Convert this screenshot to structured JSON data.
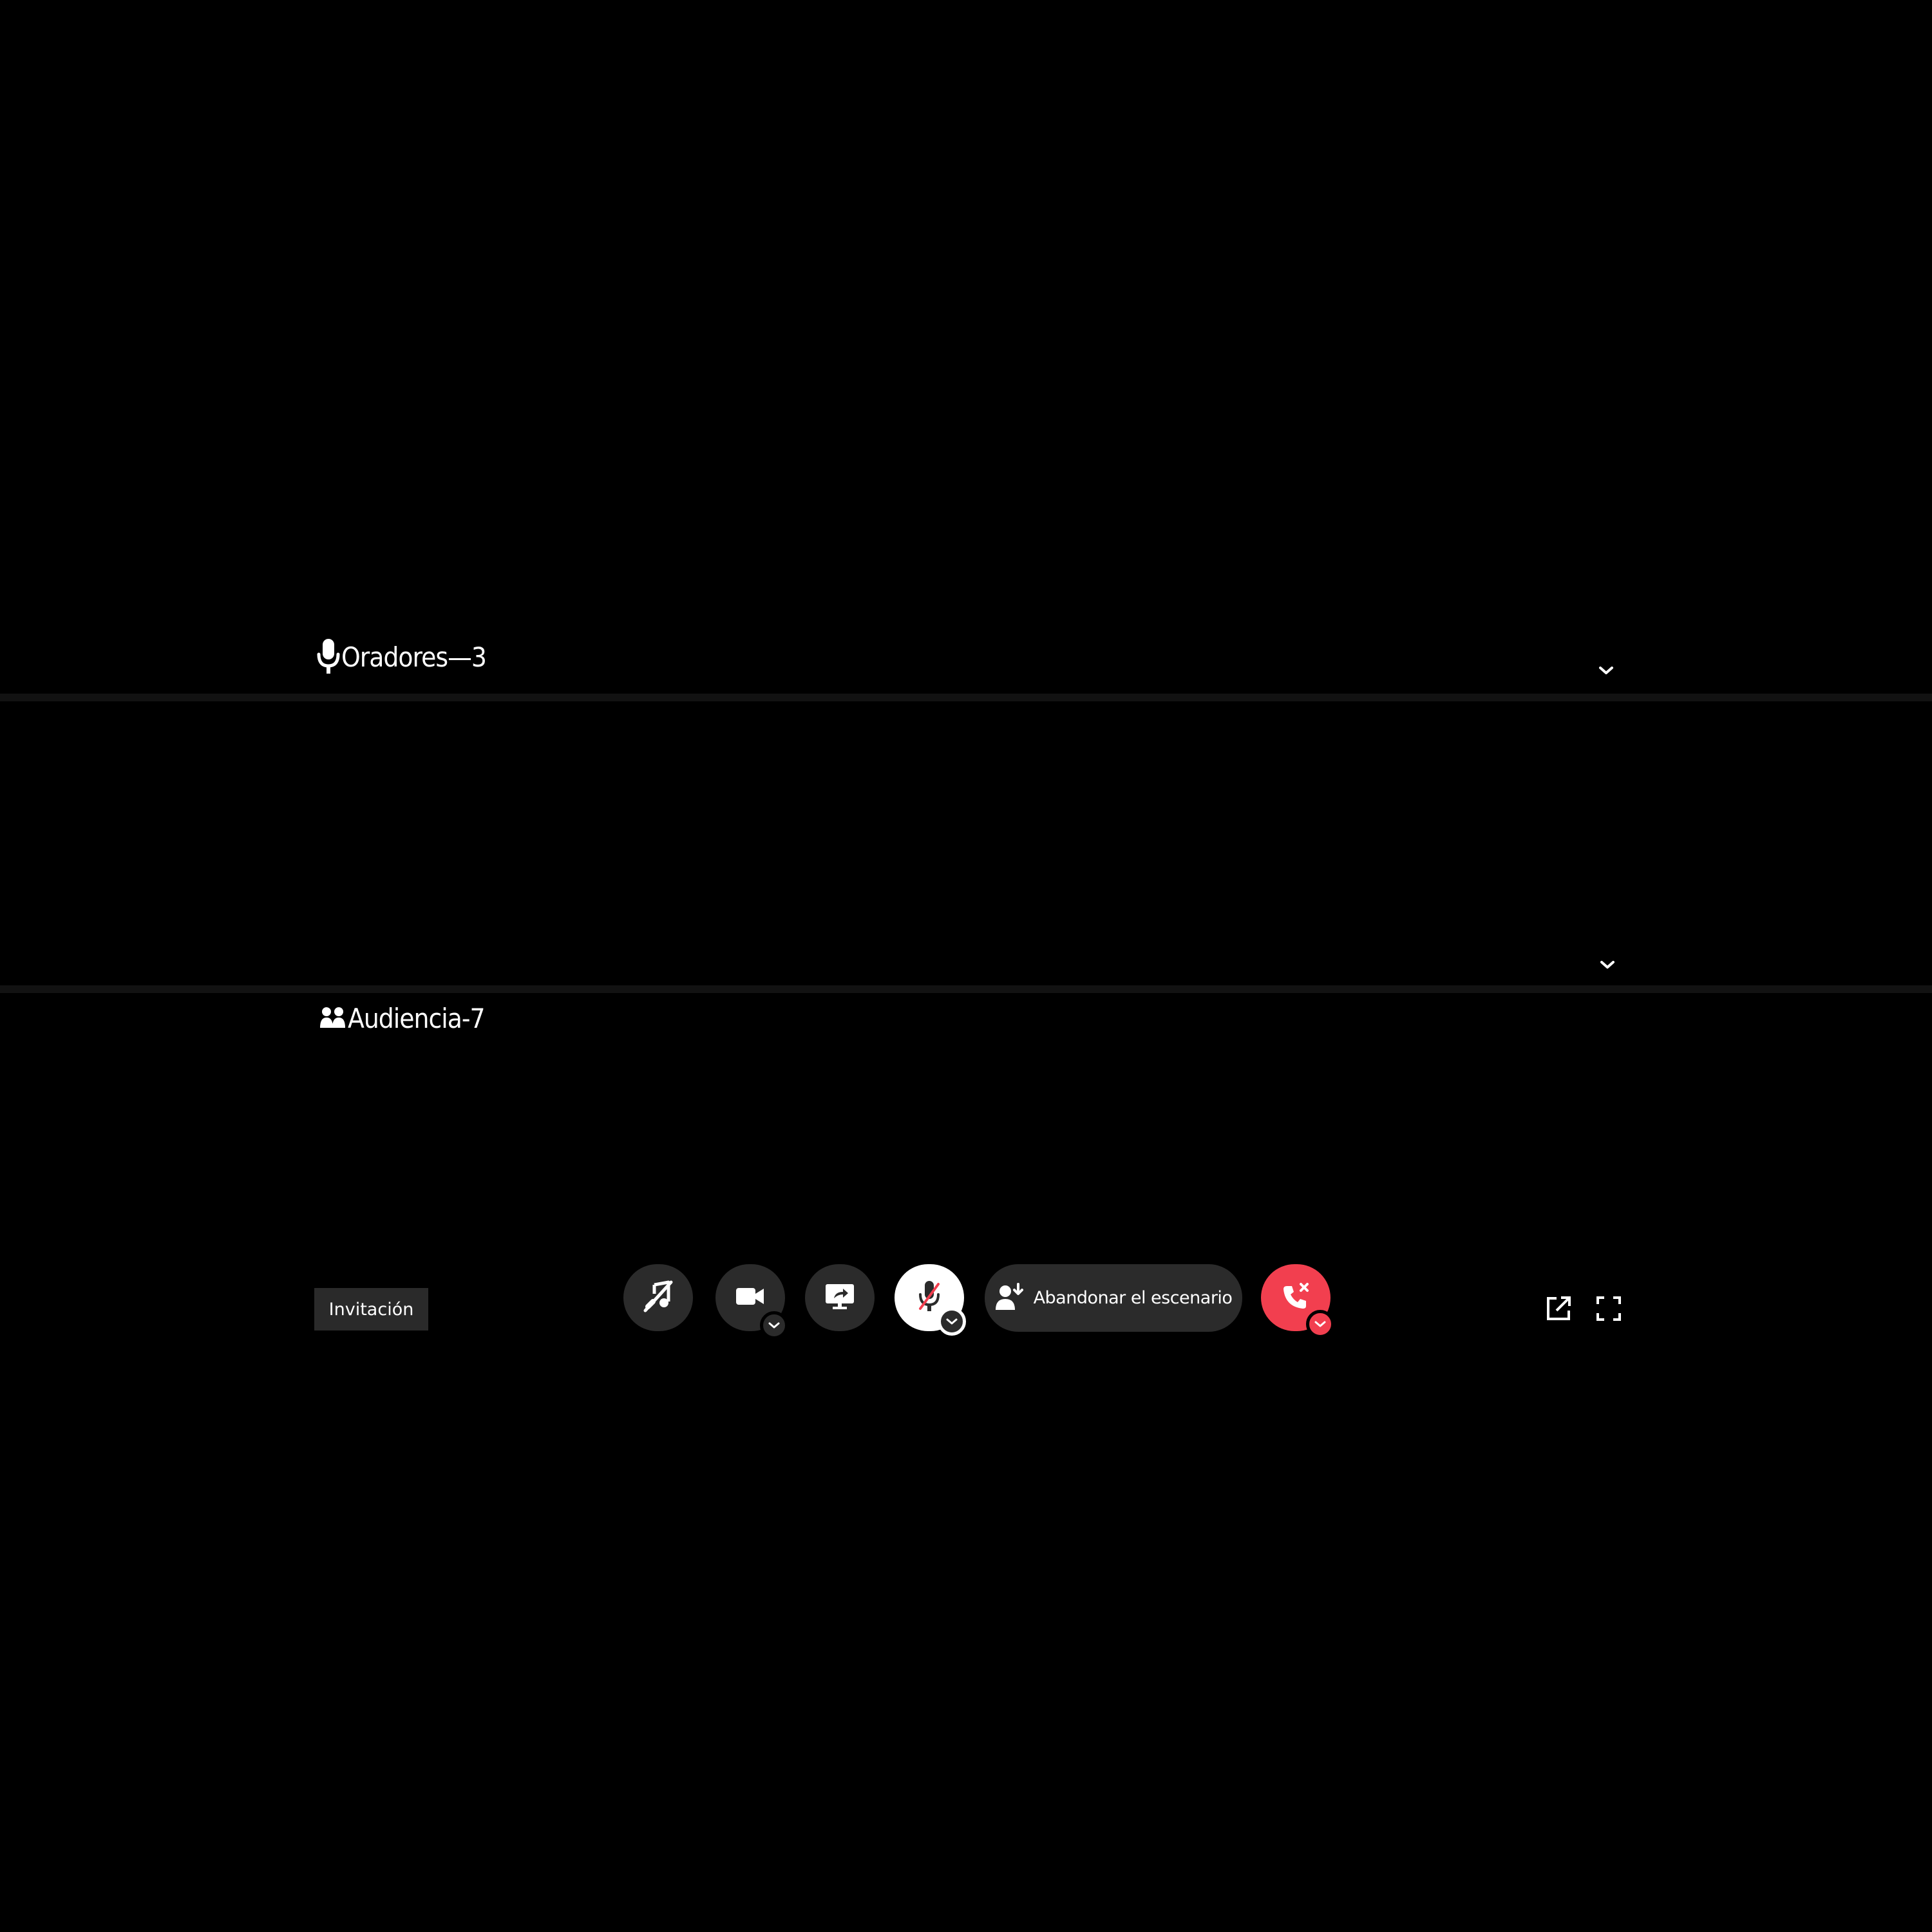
{
  "stage": {
    "speakers": {
      "label": "Oradores—3",
      "icon": "microphone-icon"
    },
    "audience": {
      "label": "Audiencia-7",
      "icon": "people-icon"
    }
  },
  "controls": {
    "invite_label": "Invitación",
    "leave_stage_label": "Abandonar el escenario",
    "icons": {
      "soundboard": "soundboard-off-icon",
      "camera": "video-camera-icon",
      "screenshare": "screen-share-icon",
      "mic": "microphone-muted-icon",
      "leave_stage": "leave-stage-icon",
      "hangup": "hang-up-phone-icon",
      "popout": "pop-out-icon",
      "fullscreen": "fullscreen-icon"
    }
  },
  "colors": {
    "background": "#000000",
    "button": "#2b2b2b",
    "danger": "#f23f4f",
    "mic_active_bg": "#ffffff"
  }
}
